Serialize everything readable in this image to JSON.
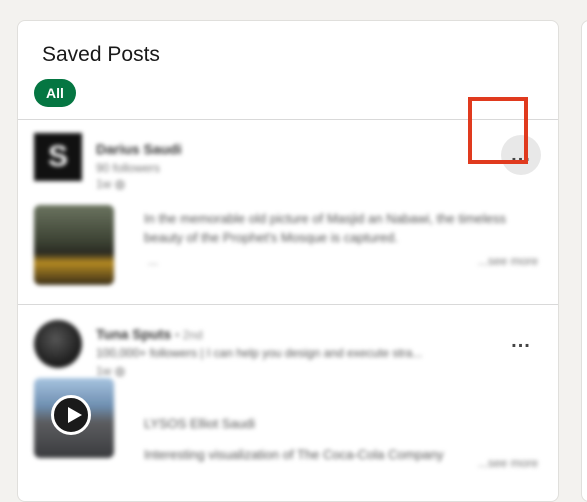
{
  "page": {
    "title": "Saved Posts",
    "filter_label": "All",
    "accent_color": "#057642",
    "highlight_color": "#e03a1e"
  },
  "posts": [
    {
      "avatar_letter": "S",
      "author": "Darius Saudi",
      "followers": "90 followers",
      "time": "1w",
      "text_line1": "In the memorable old picture of Masjid an Nabawi, the timeless",
      "text_line2": "beauty of the Prophet's Mosque is captured.",
      "ellipsis": "...",
      "see_more": "...see more",
      "more_icon": "..."
    },
    {
      "author": "Tuna Sputs",
      "headline_extra": "• 2nd",
      "headline": "100,000+ followers | I can help you design and execute stra...",
      "time": "1w",
      "text_line1": "LYSOS Elliot Saudi",
      "text_line2": "Interesting visualization of The Coca-Cola Company",
      "see_more": "...see more",
      "more_icon": "..."
    }
  ]
}
